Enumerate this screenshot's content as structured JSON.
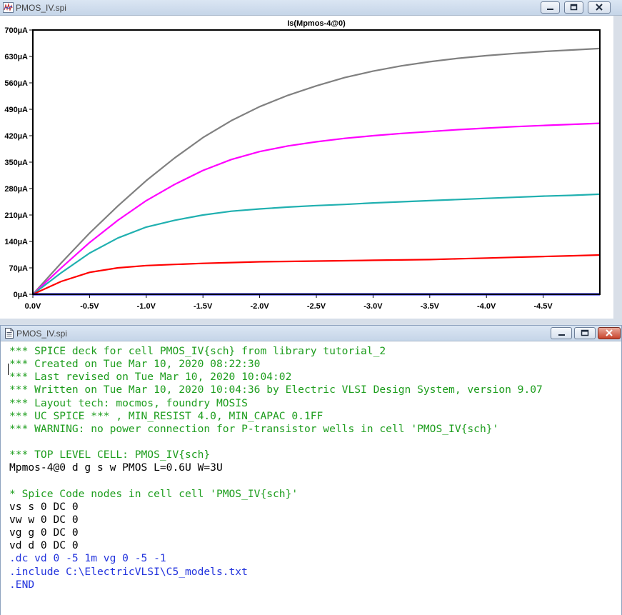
{
  "plot_window": {
    "title": "PMOS_IV.spi",
    "plot_title": "Is(Mpmos-4@0)"
  },
  "editor_window": {
    "title": "PMOS_IV.spi",
    "lines": [
      {
        "text": "*** SPICE deck for cell PMOS_IV{sch} from library tutorial_2",
        "kind": "comment"
      },
      {
        "text": "*** Created on Tue Mar 10, 2020 08:22:30",
        "kind": "comment"
      },
      {
        "text": "*** Last revised on Tue Mar 10, 2020 10:04:02",
        "kind": "comment"
      },
      {
        "text": "*** Written on Tue Mar 10, 2020 10:04:36 by Electric VLSI Design System, version 9.07",
        "kind": "comment"
      },
      {
        "text": "*** Layout tech: mocmos, foundry MOSIS",
        "kind": "comment"
      },
      {
        "text": "*** UC SPICE *** , MIN_RESIST 4.0, MIN_CAPAC 0.1FF",
        "kind": "comment"
      },
      {
        "text": "*** WARNING: no power connection for P-transistor wells in cell 'PMOS_IV{sch}'",
        "kind": "comment"
      },
      {
        "text": "",
        "kind": "code"
      },
      {
        "text": "*** TOP LEVEL CELL: PMOS_IV{sch}",
        "kind": "comment"
      },
      {
        "text": "Mpmos-4@0 d g s w PMOS L=0.6U W=3U",
        "kind": "code"
      },
      {
        "text": "",
        "kind": "code"
      },
      {
        "text": "* Spice Code nodes in cell cell 'PMOS_IV{sch}'",
        "kind": "comment"
      },
      {
        "text": "vs s 0 DC 0",
        "kind": "code"
      },
      {
        "text": "vw w 0 DC 0",
        "kind": "code"
      },
      {
        "text": "vg g 0 DC 0",
        "kind": "code"
      },
      {
        "text": "vd d 0 DC 0",
        "kind": "code"
      },
      {
        "text": ".dc vd 0 -5 1m vg 0 -5 -1",
        "kind": "dot"
      },
      {
        "text": ".include C:\\ElectricVLSI\\C5_models.txt",
        "kind": "dot"
      },
      {
        "text": ".END",
        "kind": "dot"
      }
    ]
  },
  "chart_data": {
    "type": "line",
    "title": "Is(Mpmos-4@0)",
    "xlabel": "",
    "ylabel": "",
    "x_tick_labels": [
      "0.0V",
      "-0.5V",
      "-1.0V",
      "-1.5V",
      "-2.0V",
      "-2.5V",
      "-3.0V",
      "-3.5V",
      "-4.0V",
      "-4.5V"
    ],
    "y_tick_labels": [
      "0µA",
      "70µA",
      "140µA",
      "210µA",
      "280µA",
      "350µA",
      "420µA",
      "490µA",
      "560µA",
      "630µA",
      "700µA"
    ],
    "xlim": [
      0,
      -5
    ],
    "ylim": [
      0,
      700
    ],
    "grid": false,
    "x": [
      0,
      -0.25,
      -0.5,
      -0.75,
      -1.0,
      -1.25,
      -1.5,
      -1.75,
      -2.0,
      -2.25,
      -2.5,
      -2.75,
      -3.0,
      -3.25,
      -3.5,
      -3.75,
      -4.0,
      -4.25,
      -4.5,
      -4.75,
      -5.0
    ],
    "series": [
      {
        "color": "#808080",
        "values": [
          0,
          83,
          162,
          234,
          301,
          361,
          415,
          460,
          497,
          527,
          552,
          574,
          591,
          605,
          616,
          625,
          632,
          638,
          643,
          647,
          651
        ]
      },
      {
        "color": "#ff00ff",
        "values": [
          0,
          70,
          137,
          196,
          248,
          291,
          328,
          357,
          378,
          393,
          404,
          413,
          420,
          426,
          431,
          436,
          440,
          444,
          447,
          450,
          453
        ]
      },
      {
        "color": "#20b0b0",
        "values": [
          0,
          57,
          109,
          149,
          178,
          196,
          210,
          220,
          226,
          231,
          235,
          238,
          242,
          245,
          248,
          251,
          254,
          257,
          260,
          262,
          265
        ]
      },
      {
        "color": "#ff0000",
        "values": [
          0,
          34,
          58,
          70,
          76,
          79,
          82,
          84,
          86,
          87,
          88,
          89,
          90,
          91,
          92,
          94,
          96,
          98,
          100,
          102,
          104
        ]
      },
      {
        "color": "#0000ff",
        "values": [
          0,
          0,
          0,
          0,
          0,
          0,
          0,
          0,
          0,
          0,
          0,
          0,
          0,
          0,
          0,
          0,
          0,
          0,
          0,
          0,
          0
        ]
      }
    ]
  }
}
